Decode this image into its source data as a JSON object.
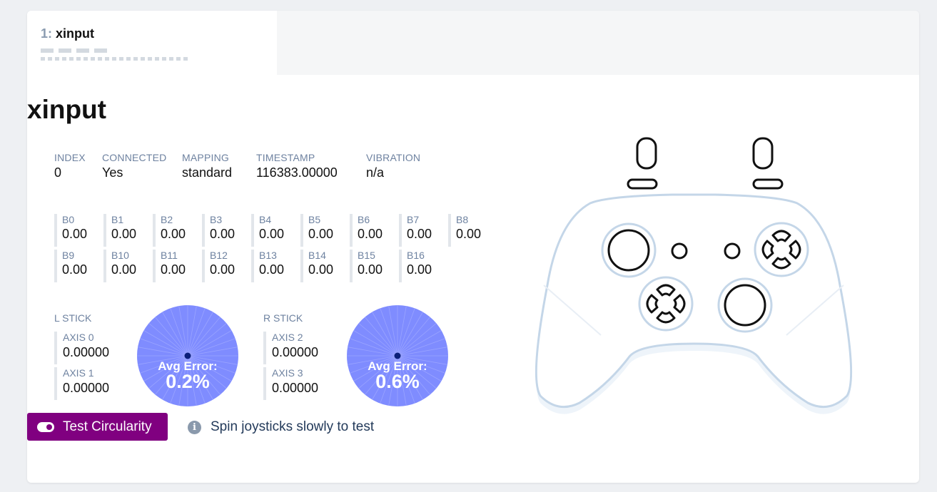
{
  "tab": {
    "number": "1:",
    "name": "xinput"
  },
  "gamepad": {
    "title": "xinput",
    "info": [
      {
        "label": "INDEX",
        "value": "0"
      },
      {
        "label": "CONNECTED",
        "value": "Yes"
      },
      {
        "label": "MAPPING",
        "value": "standard"
      },
      {
        "label": "TIMESTAMP",
        "value": "116383.00000"
      },
      {
        "label": "VIBRATION",
        "value": "n/a"
      }
    ],
    "buttons": [
      {
        "label": "B0",
        "value": "0.00"
      },
      {
        "label": "B1",
        "value": "0.00"
      },
      {
        "label": "B2",
        "value": "0.00"
      },
      {
        "label": "B3",
        "value": "0.00"
      },
      {
        "label": "B4",
        "value": "0.00"
      },
      {
        "label": "B5",
        "value": "0.00"
      },
      {
        "label": "B6",
        "value": "0.00"
      },
      {
        "label": "B7",
        "value": "0.00"
      },
      {
        "label": "B8",
        "value": "0.00"
      },
      {
        "label": "B9",
        "value": "0.00"
      },
      {
        "label": "B10",
        "value": "0.00"
      },
      {
        "label": "B11",
        "value": "0.00"
      },
      {
        "label": "B12",
        "value": "0.00"
      },
      {
        "label": "B13",
        "value": "0.00"
      },
      {
        "label": "B14",
        "value": "0.00"
      },
      {
        "label": "B15",
        "value": "0.00"
      },
      {
        "label": "B16",
        "value": "0.00"
      }
    ],
    "left_stick": {
      "label": "L STICK",
      "axes": [
        {
          "label": "AXIS 0",
          "value": "0.00000"
        },
        {
          "label": "AXIS 1",
          "value": "0.00000"
        }
      ],
      "avg_error_label": "Avg Error:",
      "avg_error": "0.2%"
    },
    "right_stick": {
      "label": "R STICK",
      "axes": [
        {
          "label": "AXIS 2",
          "value": "0.00000"
        },
        {
          "label": "AXIS 3",
          "value": "0.00000"
        }
      ],
      "avg_error_label": "Avg Error:",
      "avg_error": "0.6%"
    }
  },
  "test_button": {
    "label": "Test Circularity"
  },
  "hint": {
    "icon": "info-icon",
    "text": "Spin joysticks slowly to test"
  },
  "colors": {
    "accent": "#800080",
    "circle_fill": "#7f8cff",
    "controller_outline": "#c4d6e8",
    "label": "#6e82a0"
  }
}
